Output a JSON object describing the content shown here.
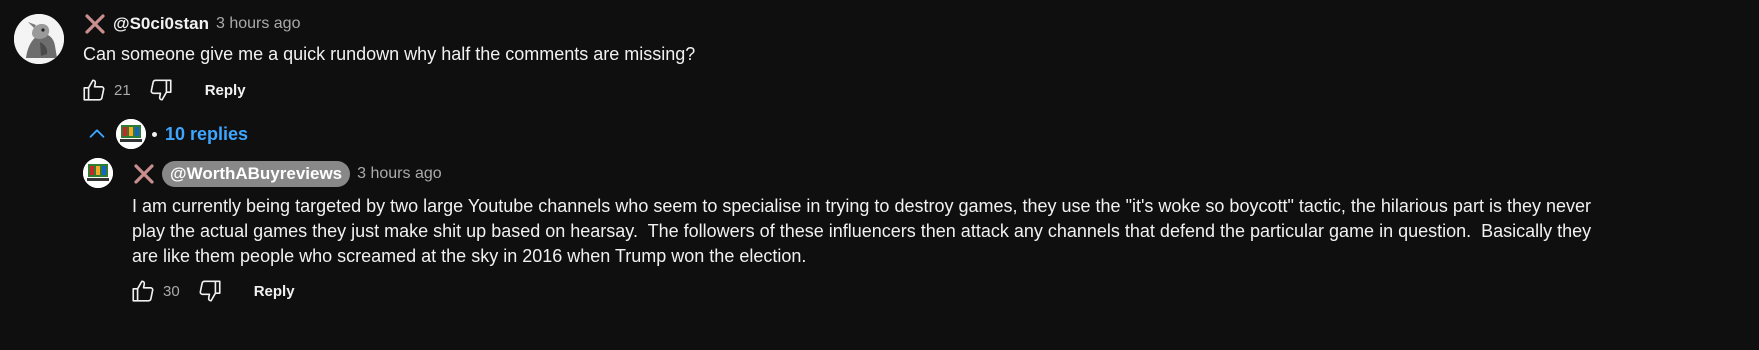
{
  "comment": {
    "avatar": "user-avatar",
    "mod_icon": "x-mark-icon",
    "handle": "@S0ci0stan",
    "time": "3 hours ago",
    "text": "Can someone give me a quick rundown why half the comments are missing?",
    "likes": "21",
    "reply_label": "Reply"
  },
  "replies_toggle": {
    "icon": "chevron-up-icon",
    "label": "10 replies"
  },
  "reply": {
    "avatar": "channel-avatar",
    "mod_icon": "x-mark-icon",
    "handle": "@WorthABuyreviews",
    "time": "3 hours ago",
    "text_line1": "I am currently being targeted by two large Youtube channels who seem to specialise in trying to destroy games, they use the \"it's woke so boycott\" tactic, the hilarious part is they never",
    "text_line2": "play the actual games they just make shit up based on hearsay.  The followers of these influencers then attack any channels that defend the particular game in question.  Basically they",
    "text_line3": "are like them people who screamed at the sky in 2016 when Trump won the election.",
    "likes": "30",
    "reply_label": "Reply"
  },
  "colors": {
    "background": "#0f0f0f",
    "link": "#3ea6ff",
    "mod_x": "#c98f8f",
    "secondary_text": "#aaaaaa"
  }
}
